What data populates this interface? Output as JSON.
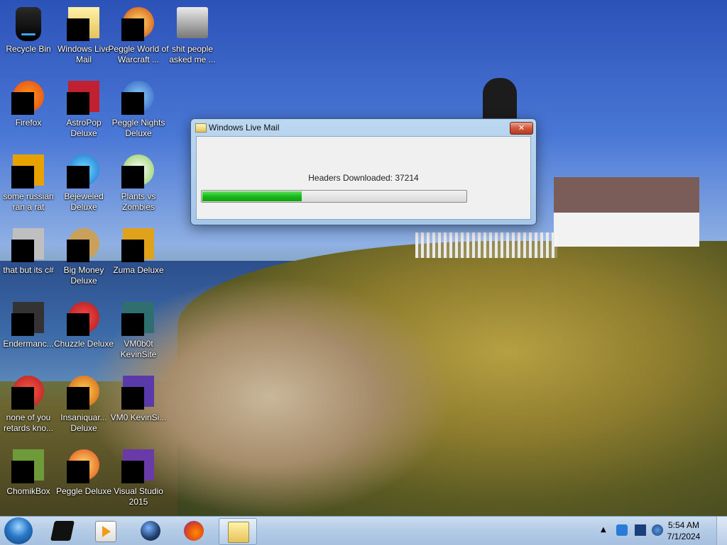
{
  "desktop": {
    "icons": [
      {
        "label": "Recycle Bin"
      },
      {
        "label": "Windows Live Mail"
      },
      {
        "label": "Peggle World of Warcraft ..."
      },
      {
        "label": "shit people asked me ..."
      },
      {
        "label": "Firefox"
      },
      {
        "label": "AstroPop Deluxe"
      },
      {
        "label": "Peggle Nights Deluxe"
      },
      {
        "label": "some russian ran a rat"
      },
      {
        "label": "Bejeweled Deluxe"
      },
      {
        "label": "Plants vs Zombies"
      },
      {
        "label": "that but its c#"
      },
      {
        "label": "Big Money Deluxe"
      },
      {
        "label": "Zuma Deluxe"
      },
      {
        "label": "Endermanc..."
      },
      {
        "label": "Chuzzle Deluxe"
      },
      {
        "label": "VM0b0t KevinSite"
      },
      {
        "label": "none of you retards kno..."
      },
      {
        "label": "Insaniquar... Deluxe"
      },
      {
        "label": "VM0 KevinSi..."
      },
      {
        "label": "ChomikBox"
      },
      {
        "label": "Peggle Deluxe"
      },
      {
        "label": "Visual Studio 2015"
      }
    ]
  },
  "dialog": {
    "title": "Windows Live Mail",
    "close_label": "✕",
    "status_text": "Headers Downloaded: 37214",
    "progress_fraction": 0.38
  },
  "taskbar": {
    "apps": [
      {
        "icon": "generic-box-icon"
      },
      {
        "icon": "media-player-icon"
      },
      {
        "icon": "globe-icon"
      },
      {
        "icon": "firefox-icon"
      },
      {
        "icon": "windows-live-mail-icon"
      }
    ],
    "clock": {
      "time": "5:54 AM",
      "date": "7/1/2024"
    }
  },
  "colors": {
    "accent": "#2a78c8",
    "progress": "#19b919",
    "close": "#d2553c"
  }
}
